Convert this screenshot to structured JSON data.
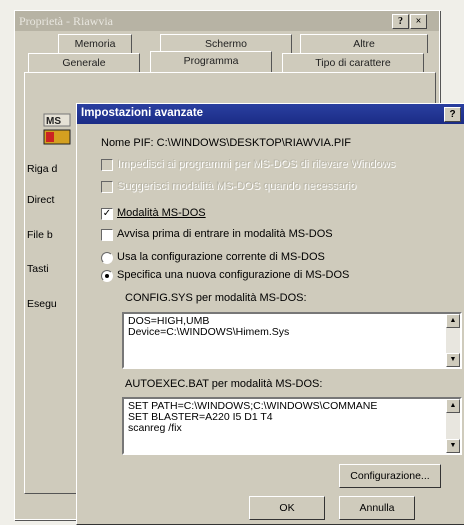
{
  "outer": {
    "title": "Proprietà - Riawvia",
    "help_btn": "?",
    "close_btn": "×",
    "tabs_row1": [
      "Memoria",
      "Schermo",
      "Altre"
    ],
    "tabs_row2": [
      "Generale",
      "Programma",
      "Tipo di carattere"
    ],
    "side_labels": [
      "Riga d",
      "Direct",
      "File b",
      "Tasti",
      "Esegu"
    ]
  },
  "inner": {
    "title": "Impostazioni avanzate",
    "help_btn": "?",
    "close_btn": "×",
    "pif_label": "Nome PIF:",
    "pif_value": "C:\\WINDOWS\\DESKTOP\\RIAWVIA.PIF",
    "opt_disabled1": "Impedisci ai programmi per MS-DOS di rilevare Windows",
    "opt_disabled2": "Suggerisci modalità MS-DOS quando necessario",
    "opt_msdos": "Modalità MS-DOS",
    "opt_avvisa": "Avvisa prima di entrare in modalità MS-DOS",
    "opt_usa": "Usa la configurazione corrente di MS-DOS",
    "opt_specifica": "Specifica una nuova configurazione di MS-DOS",
    "config_label": "CONFIG.SYS per modalità MS-DOS:",
    "config_lines": [
      "DOS=HIGH,UMB",
      "Device=C:\\WINDOWS\\Himem.Sys"
    ],
    "autoexec_label": "AUTOEXEC.BAT per modalità MS-DOS:",
    "autoexec_lines": [
      "SET PATH=C:\\WINDOWS;C:\\WINDOWS\\COMMANE",
      "SET BLASTER=A220 I5 D1 T4",
      "scanreg /fix"
    ],
    "config_btn": "Configurazione...",
    "ok_btn": "OK",
    "cancel_btn": "Annulla"
  }
}
